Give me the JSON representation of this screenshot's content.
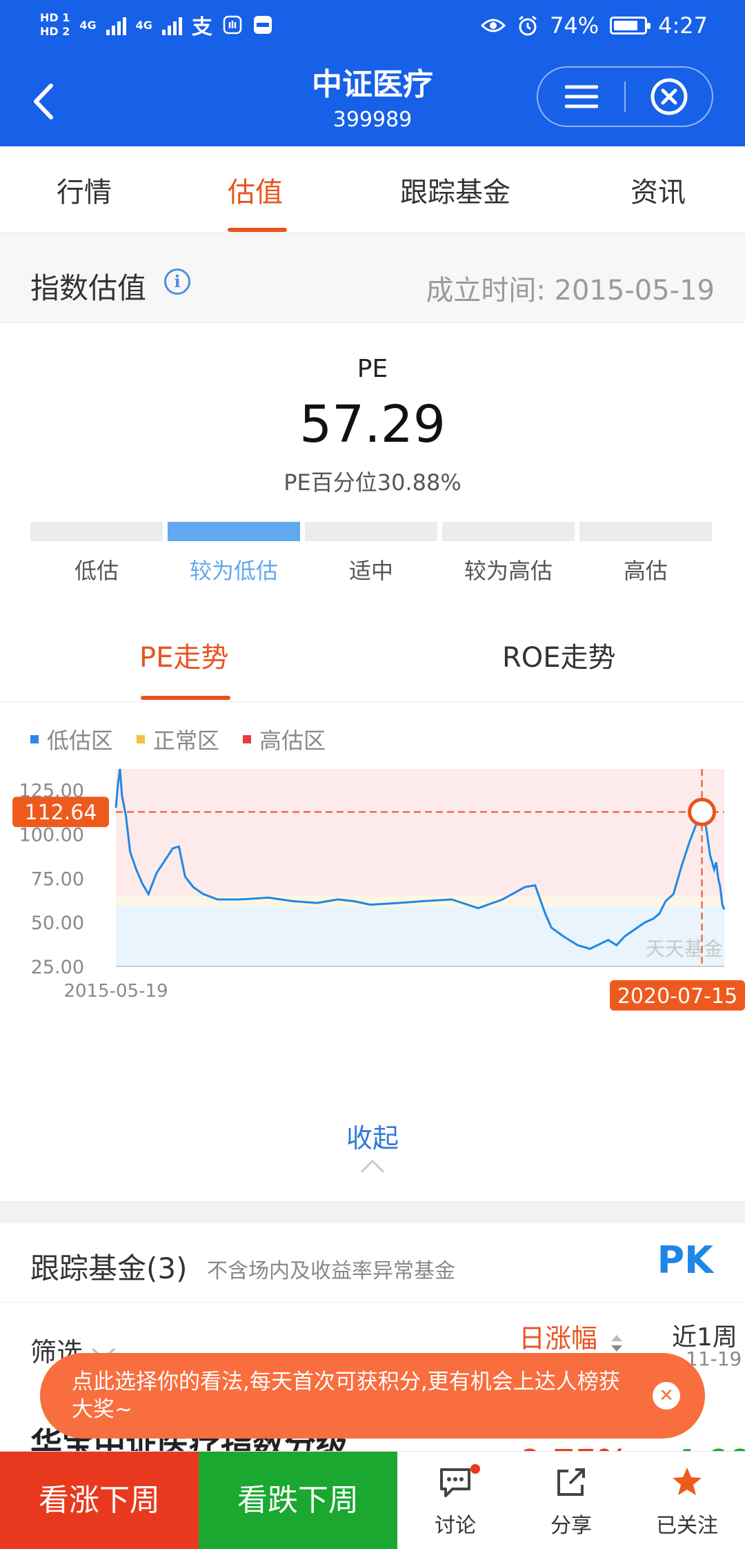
{
  "status": {
    "hd1": "HD 1",
    "hd2": "HD 2",
    "net1": "4G",
    "net2": "4G",
    "battery_pct": "74%",
    "time": "4:27"
  },
  "header": {
    "title": "中证医疗",
    "code": "399989"
  },
  "tabs": [
    "行情",
    "估值",
    "跟踪基金",
    "资讯"
  ],
  "active_tab": "估值",
  "valuation": {
    "section_title": "指数估值",
    "founded": "成立时间: 2015-05-19",
    "metric_label": "PE",
    "metric_value": "57.29",
    "percentile_text": "PE百分位30.88%",
    "levels": [
      "低估",
      "较为低估",
      "适中",
      "较为高估",
      "高估"
    ],
    "active_level": "较为低估"
  },
  "trend_tabs": [
    "PE走势",
    "ROE走势"
  ],
  "legend": [
    {
      "label": "低估区",
      "color": "#2f86ea"
    },
    {
      "label": "正常区",
      "color": "#f5c040"
    },
    {
      "label": "高估区",
      "color": "#ea3a3a"
    }
  ],
  "chart_data": {
    "type": "line",
    "title": "",
    "xlabel": "",
    "ylabel": "",
    "y_ticks": [
      "125.00",
      "100.00",
      "75.00",
      "50.00",
      "25.00"
    ],
    "ylim": [
      25,
      137
    ],
    "x_start_label": "2015-05-19",
    "x_cursor_label": "2020-07-15",
    "cursor_value_label": "112.64",
    "cursor_value": 112.64,
    "zones": {
      "low_max": 59,
      "normal_max": 65,
      "high_max": 137
    },
    "series": [
      {
        "color": "#1e88e5",
        "points": [
          [
            "2015-05-19",
            115
          ],
          [
            "2015-05-26",
            128
          ],
          [
            "2015-06-02",
            137
          ],
          [
            "2015-06-09",
            122
          ],
          [
            "2015-06-23",
            110
          ],
          [
            "2015-07-07",
            90
          ],
          [
            "2015-07-28",
            80
          ],
          [
            "2015-08-18",
            72
          ],
          [
            "2015-09-08",
            66
          ],
          [
            "2015-10-06",
            78
          ],
          [
            "2015-11-03",
            85
          ],
          [
            "2015-12-01",
            92
          ],
          [
            "2015-12-22",
            93
          ],
          [
            "2016-01-12",
            76
          ],
          [
            "2016-02-09",
            70
          ],
          [
            "2016-03-15",
            66
          ],
          [
            "2016-05-03",
            63
          ],
          [
            "2016-07-19",
            63
          ],
          [
            "2016-10-25",
            64
          ],
          [
            "2017-01-17",
            62
          ],
          [
            "2017-04-11",
            61
          ],
          [
            "2017-06-20",
            63
          ],
          [
            "2017-08-15",
            62
          ],
          [
            "2017-10-10",
            60
          ],
          [
            "2018-01-16",
            61
          ],
          [
            "2018-04-10",
            62
          ],
          [
            "2018-07-17",
            63
          ],
          [
            "2018-10-16",
            58
          ],
          [
            "2019-01-08",
            63
          ],
          [
            "2019-03-26",
            70
          ],
          [
            "2019-04-30",
            71
          ],
          [
            "2019-06-04",
            55
          ],
          [
            "2019-06-25",
            47
          ],
          [
            "2019-08-06",
            42
          ],
          [
            "2019-09-24",
            37
          ],
          [
            "2019-11-05",
            35
          ],
          [
            "2020-01-07",
            40
          ],
          [
            "2020-02-04",
            37
          ],
          [
            "2020-03-03",
            42
          ],
          [
            "2020-04-07",
            46
          ],
          [
            "2020-05-12",
            50
          ],
          [
            "2020-06-09",
            52
          ],
          [
            "2020-07-01",
            55
          ],
          [
            "2020-07-22",
            62
          ],
          [
            "2020-08-18",
            66
          ],
          [
            "2020-09-15",
            82
          ],
          [
            "2020-10-13",
            96
          ],
          [
            "2020-11-10",
            108
          ],
          [
            "2020-11-24",
            112.64
          ],
          [
            "2020-12-08",
            104
          ],
          [
            "2020-12-22",
            88
          ],
          [
            "2021-01-05",
            80
          ],
          [
            "2021-01-12",
            84
          ],
          [
            "2021-01-19",
            75
          ],
          [
            "2021-01-26",
            70
          ],
          [
            "2021-02-02",
            60
          ],
          [
            "2021-02-09",
            57.29
          ]
        ]
      }
    ],
    "watermark": "天天基金",
    "grid": false
  },
  "collapse_label": "收起",
  "funds": {
    "title": "跟踪基金(3)",
    "note": "不含场内及收益率异常基金",
    "pk_label": "PK",
    "filter_label": "筛选",
    "col_day": "日涨幅",
    "col_week": "近1周",
    "col_week_sub": "11-19",
    "first_fund_name": "华宝中证医疗指数分级",
    "first_fund_day": "0.75%",
    "first_fund_week": "4.09"
  },
  "toast": {
    "text": "点此选择你的看法,每天首次可获积分,更有机会上达人榜获大奖~"
  },
  "bottom_bar": {
    "bull_label": "看涨下周",
    "bear_label": "看跌下周",
    "items": [
      {
        "label": "讨论",
        "icon": "discuss-icon"
      },
      {
        "label": "分享",
        "icon": "share-icon"
      },
      {
        "label": "已关注",
        "icon": "star-icon"
      }
    ]
  }
}
